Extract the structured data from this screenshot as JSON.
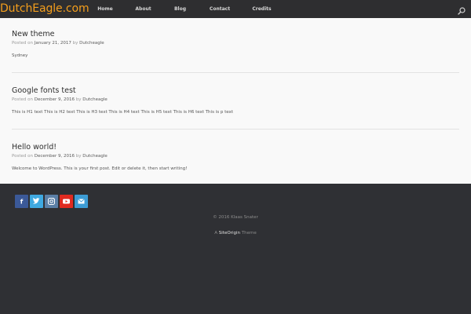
{
  "site": {
    "logo": "DutchEagle.com"
  },
  "nav": {
    "items": [
      "Home",
      "About",
      "Blog",
      "Contact",
      "Credits"
    ]
  },
  "posts": [
    {
      "title": "New theme",
      "meta_prefix": "Posted on",
      "date": "January 21, 2017",
      "by": "by",
      "author": "Dutcheagle",
      "body": "Sydney"
    },
    {
      "title": "Google fonts test",
      "meta_prefix": "Posted on",
      "date": "December 9, 2016",
      "by": "by",
      "author": "Dutcheagle",
      "body": "This is H1 text This is H2 text This is H3 text This is H4 text This is H5 text This is H6 text This is p text"
    },
    {
      "title": "Hello world!",
      "meta_prefix": "Posted on",
      "date": "December 9, 2016",
      "by": "by",
      "author": "Dutcheagle",
      "body": "Welcome to WordPress. This is your first post. Edit or delete it, then start writing!"
    }
  ],
  "footer": {
    "social": [
      {
        "icon": "facebook-icon",
        "color": "#3b5998",
        "glyph": "f"
      },
      {
        "icon": "twitter-icon",
        "color": "#3fa9e1",
        "glyph": "t"
      },
      {
        "icon": "instagram-icon",
        "color": "#5b7fa6",
        "glyph": "◎"
      },
      {
        "icon": "youtube-icon",
        "color": "#e02a20",
        "glyph": "▶"
      },
      {
        "icon": "email-icon",
        "color": "#3d9cd4",
        "glyph": "✉"
      }
    ],
    "copyright": "© 2016 Klaas Snater",
    "credit_prefix": "A",
    "credit_brand": "SiteOrigin",
    "credit_suffix": "Theme"
  },
  "colors": {
    "accent": "#f49e1c",
    "topbar": "#2e2e30",
    "footer": "#2f3034"
  }
}
